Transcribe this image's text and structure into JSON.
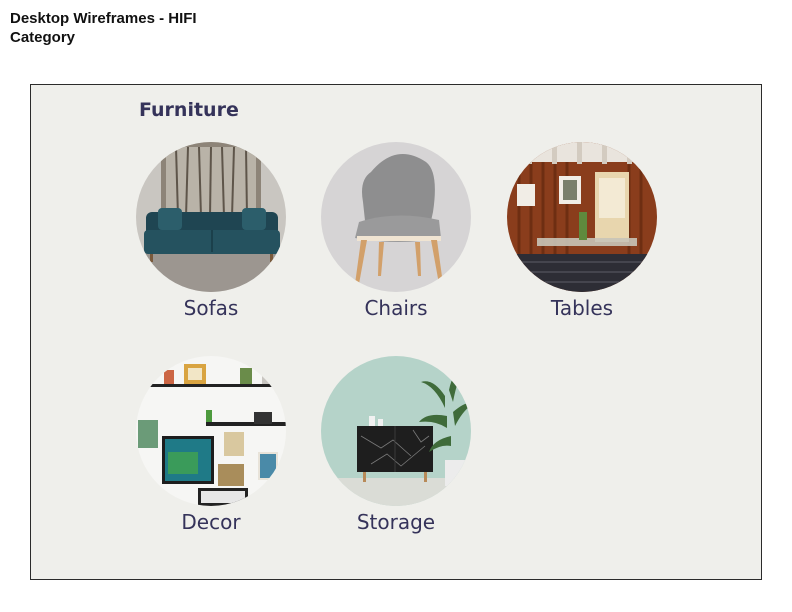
{
  "header": {
    "title_line1": "Desktop Wireframes - HIFI",
    "title_line2": "Category"
  },
  "section": {
    "title": "Furniture"
  },
  "categories": [
    {
      "label": "Sofas",
      "image": "sofa-photo"
    },
    {
      "label": "Chairs",
      "image": "chair-photo"
    },
    {
      "label": "Tables",
      "image": "dining-room-photo"
    },
    {
      "label": "Decor",
      "image": "gallery-wall-photo"
    },
    {
      "label": "Storage",
      "image": "sideboard-photo"
    }
  ],
  "colors": {
    "frame_bg": "#efefeb",
    "label_text": "#35335a",
    "heading_text": "#111111"
  }
}
